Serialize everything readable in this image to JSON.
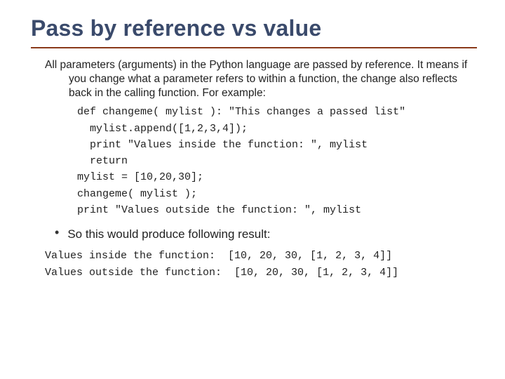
{
  "title": "Pass by reference vs value",
  "paragraph": "All parameters (arguments) in the Python language are passed by reference. It means if you change what a parameter refers to within a function, the change also reflects back in the calling function. For example:",
  "code": "def changeme( mylist ): \"This changes a passed list\"\n  mylist.append([1,2,3,4]);\n  print \"Values inside the function: \", mylist\n  return\nmylist = [10,20,30];\nchangeme( mylist );\nprint \"Values outside the function: \", mylist",
  "bullet": "So this would produce following result:",
  "output": "Values inside the function:  [10, 20, 30, [1, 2, 3, 4]]\nValues outside the function:  [10, 20, 30, [1, 2, 3, 4]]"
}
